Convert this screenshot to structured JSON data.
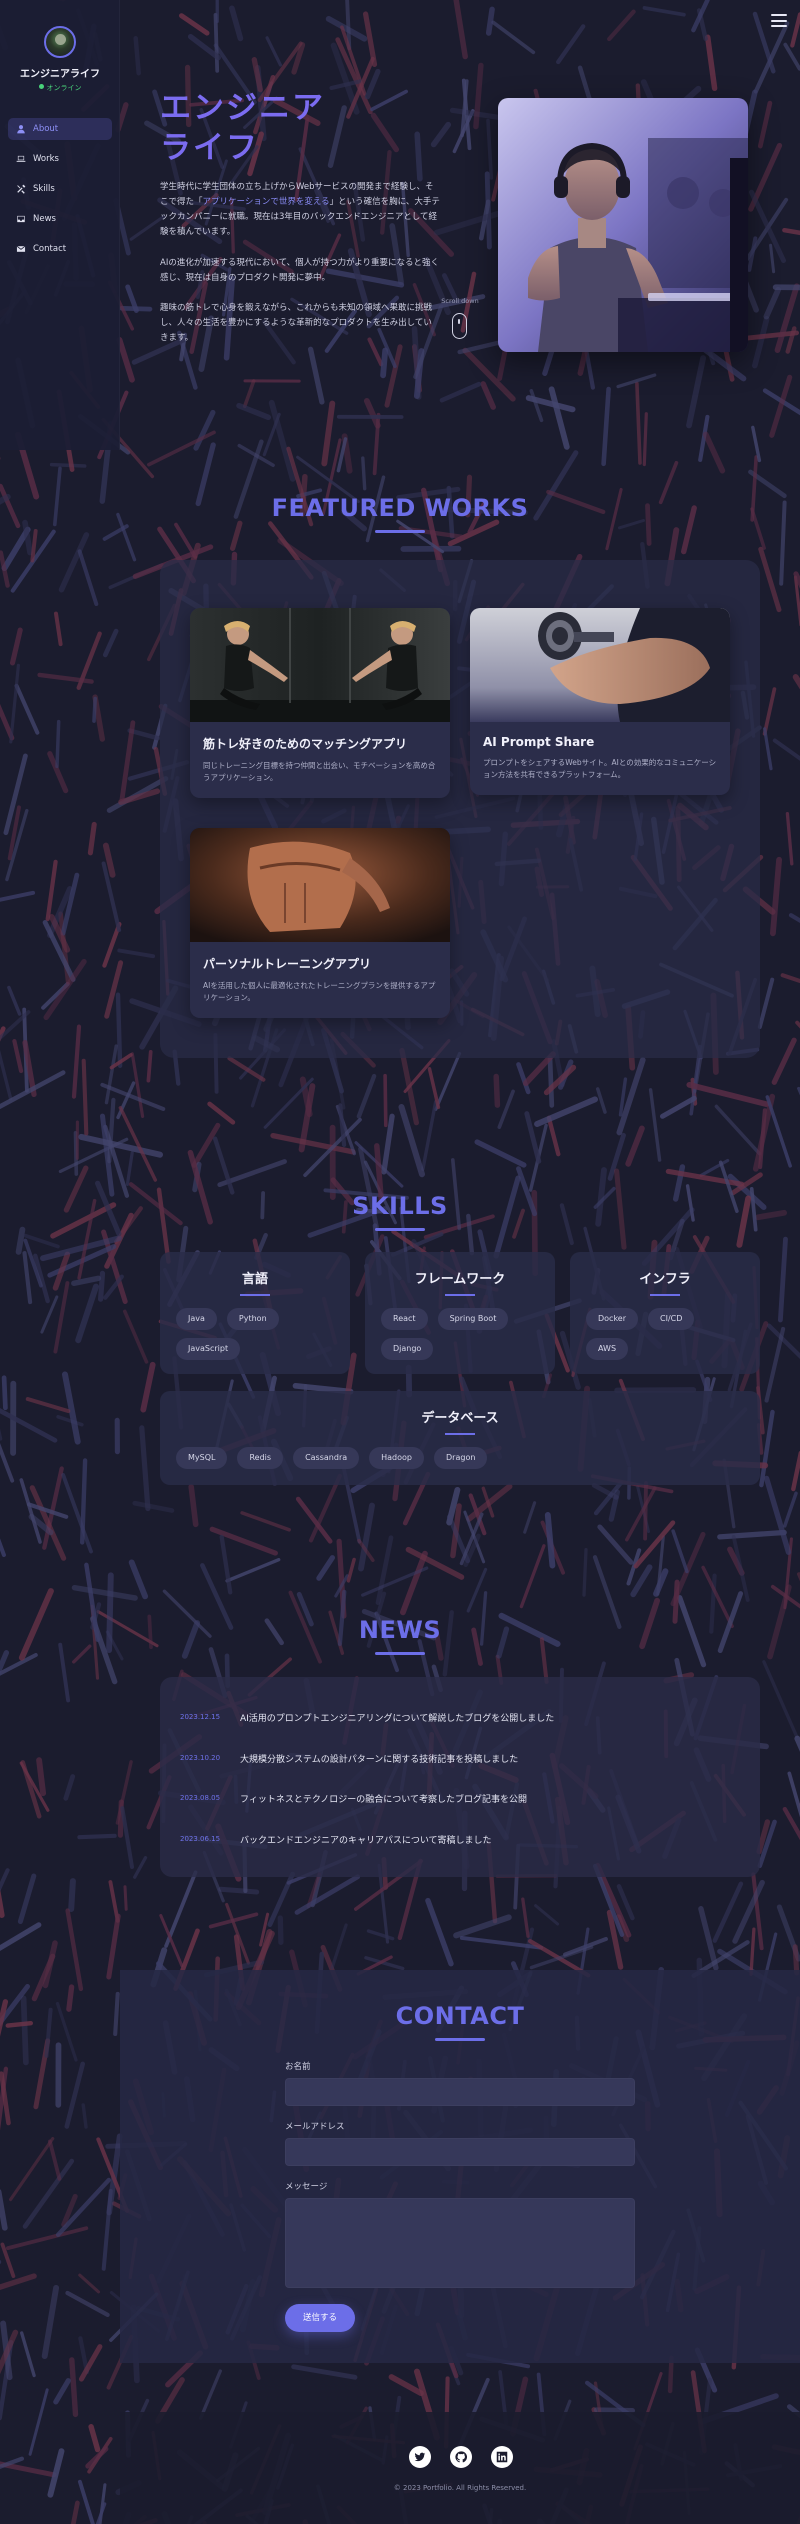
{
  "sidebar": {
    "site_title": "エンジニアライフ",
    "status": "オンライン",
    "nav": [
      {
        "label": "About",
        "icon": "user-icon"
      },
      {
        "label": "Works",
        "icon": "laptop-icon"
      },
      {
        "label": "Skills",
        "icon": "tools-icon"
      },
      {
        "label": "News",
        "icon": "inbox-icon"
      },
      {
        "label": "Contact",
        "icon": "envelope-icon"
      }
    ],
    "active_index": 0
  },
  "hero": {
    "title_line1": "エンジニア",
    "title_line2": "ライフ",
    "p1_before": "学生時代に学生団体の立ち上げからWebサービスの開発まで経験し、そこで得た「",
    "p1_highlight": "アプリケーションで世界を変える",
    "p1_after": "」という確信を胸に、大手テックカンパニーに就職。現在は3年目のバックエンドエンジニアとして経験を積んでいます。",
    "p2": "AIの進化が加速する現代において、個人が持つ力がより重要になると強く感じ、現在は自身のプロダクト開発に夢中。",
    "p3": "趣味の筋トレで心身を鍛えながら、これからも未知の領域へ果敢に挑戦し、人々の生活を豊かにするような革新的なプロダクトを生み出していきます。",
    "scroll_hint": "Scroll down"
  },
  "works": {
    "title": "FEATURED WORKS",
    "items": [
      {
        "title": "筋トレ好きのためのマッチングアプリ",
        "desc": "同じトレーニング目標を持つ仲間と出会い、モチベーションを高め合うアプリケーション。"
      },
      {
        "title": "AI Prompt Share",
        "desc": "プロンプトをシェアするWebサイト。AIとの効果的なコミュニケーション方法を共有できるプラットフォーム。"
      },
      {
        "title": "パーソナルトレーニングアプリ",
        "desc": "AIを活用した個人に最適化されたトレーニングプランを提供するアプリケーション。"
      }
    ]
  },
  "skills": {
    "title": "SKILLS",
    "groups": [
      {
        "name": "言語",
        "tags": [
          "Java",
          "Python",
          "JavaScript"
        ]
      },
      {
        "name": "フレームワーク",
        "tags": [
          "React",
          "Spring Boot",
          "Django"
        ]
      },
      {
        "name": "インフラ",
        "tags": [
          "Docker",
          "CI/CD",
          "AWS"
        ]
      },
      {
        "name": "データベース",
        "tags": [
          "MySQL",
          "Redis",
          "Cassandra",
          "Hadoop",
          "Dragon"
        ]
      }
    ]
  },
  "news": {
    "title": "NEWS",
    "items": [
      {
        "date": "2023.12.15",
        "text": "AI活用のプロンプトエンジニアリングについて解説したブログを公開しました"
      },
      {
        "date": "2023.10.20",
        "text": "大規模分散システムの設計パターンに関する技術記事を投稿しました"
      },
      {
        "date": "2023.08.05",
        "text": "フィットネスとテクノロジーの融合について考察したブログ記事を公開"
      },
      {
        "date": "2023.06.15",
        "text": "バックエンドエンジニアのキャリアパスについて寄稿しました"
      }
    ]
  },
  "contact": {
    "title": "CONTACT",
    "name_label": "お名前",
    "email_label": "メールアドレス",
    "message_label": "メッセージ",
    "submit_label": "送信する"
  },
  "footer": {
    "social": [
      {
        "icon": "twitter-icon"
      },
      {
        "icon": "github-icon"
      },
      {
        "icon": "linkedin-icon"
      }
    ],
    "copyright": "© 2023 Portfolio. All Rights Reserved."
  },
  "colors": {
    "background": "#1b1c2e",
    "accent": "#6c6ee8",
    "hero_title": "#7b6cf0",
    "online": "#49d27a",
    "card": "#2b2d4a"
  }
}
